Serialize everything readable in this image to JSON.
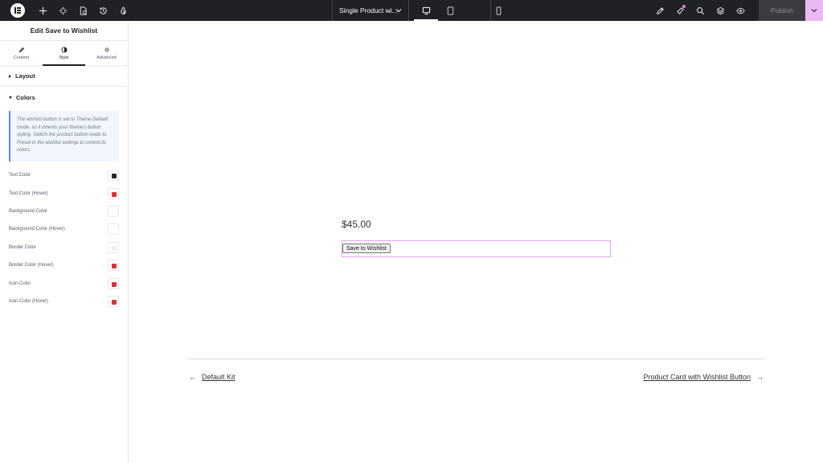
{
  "topbar": {
    "document_title": "Single Product wi...",
    "publish_label": "Publish",
    "left_icons": [
      "elementor-logo-icon",
      "plus-icon",
      "structure-icon",
      "pages-icon",
      "history-icon",
      "theme-style-icon"
    ],
    "devices": [
      "desktop-icon",
      "tablet-icon",
      "mobile-icon"
    ],
    "active_device": "desktop",
    "right_icons": [
      "pen-icon",
      "notifications-icon",
      "search-icon",
      "layers-icon",
      "preview-icon"
    ]
  },
  "panel": {
    "title": "Edit Save to Wishlist",
    "tabs": [
      {
        "label": "Content",
        "icon": "pencil-icon"
      },
      {
        "label": "Style",
        "icon": "half-circle-icon"
      },
      {
        "label": "Advanced",
        "icon": "gear-icon"
      }
    ],
    "active_tab": "Style",
    "sections": {
      "layout": "Layout",
      "colors": "Colors"
    },
    "notice": "The wishlist button is set to Theme Default mode, so it inherits your theme's button styling. Switch the product button mode to Preset in the wishlist settings to control its colors.",
    "color_controls": [
      {
        "label": "Text Color",
        "color": "#1f2b3a"
      },
      {
        "label": "Text Color (Hover)",
        "color": "#d63638"
      },
      {
        "label": "Background Color",
        "color": "#ffffff"
      },
      {
        "label": "Background Color (Hover)",
        "color": "#ffffff"
      },
      {
        "label": "Border Color",
        "color": "#eeeeee"
      },
      {
        "label": "Border Color (Hover)",
        "color": "#d63638"
      },
      {
        "label": "Icon Color",
        "color": "#d63638"
      },
      {
        "label": "Icon Color (Hover)",
        "color": "#d63638"
      }
    ]
  },
  "canvas": {
    "price": "$45.00",
    "wishlist_button": "Save to Wishlist",
    "prev_link": "Default Kit",
    "next_link": "Product Card with Wishlist Button",
    "prev_arrow": "←",
    "next_arrow": "→"
  },
  "colors": {
    "topbar_bg": "#1f2124",
    "accent": "#e8b9f3",
    "selection_outline": "#e6a1f3"
  }
}
